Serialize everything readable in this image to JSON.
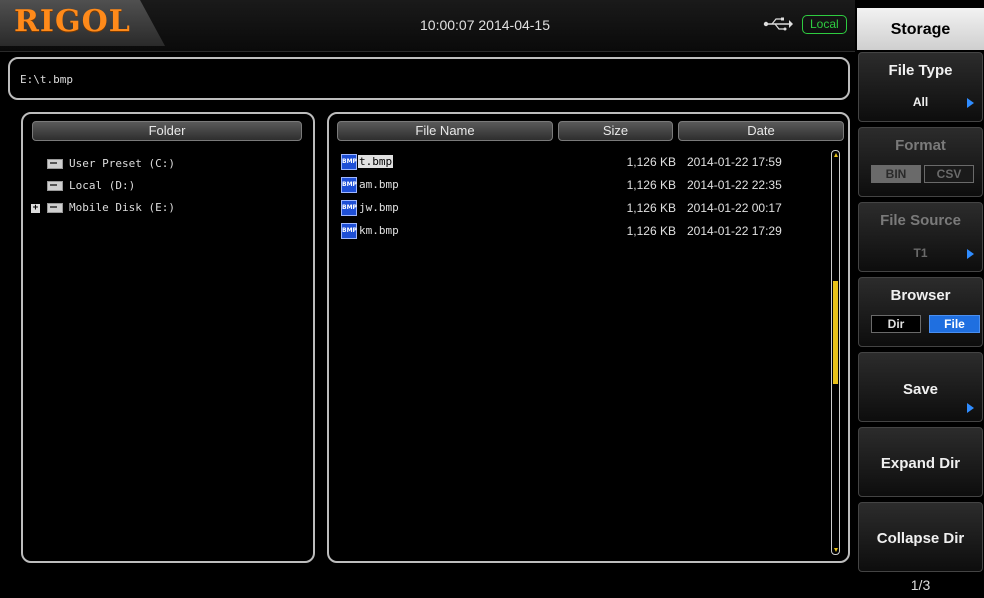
{
  "header": {
    "logo": "RIGOL",
    "datetime": "10:00:07 2014-04-15",
    "usb_icon": "usb-icon",
    "mode_badge": "Local",
    "colors": {
      "logo": "#ff8a1a",
      "badge": "#2ecc40",
      "accent": "#2f8cff",
      "scroll": "#e8c21a"
    }
  },
  "path": {
    "value": "E:\\t.bmp"
  },
  "folder_panel": {
    "header": "Folder",
    "items": [
      {
        "label": "User Preset (C:)",
        "expandable": false
      },
      {
        "label": "Local (D:)",
        "expandable": false
      },
      {
        "label": "Mobile Disk (E:)",
        "expandable": true,
        "selected": true
      }
    ]
  },
  "file_panel": {
    "columns": {
      "name": "File Name",
      "size": "Size",
      "date": "Date"
    },
    "icon_text": "BMP",
    "files": [
      {
        "name": "t.bmp",
        "size": "1,126 KB",
        "date": "2014-01-22 17:59",
        "selected": true
      },
      {
        "name": "am.bmp",
        "size": "1,126 KB",
        "date": "2014-01-22 22:35",
        "selected": false
      },
      {
        "name": "jw.bmp",
        "size": "1,126 KB",
        "date": "2014-01-22 00:17",
        "selected": false
      },
      {
        "name": "km.bmp",
        "size": "1,126 KB",
        "date": "2014-01-22 17:29",
        "selected": false
      }
    ]
  },
  "menu": {
    "title": "Storage",
    "file_type": {
      "label": "File Type",
      "value": "All"
    },
    "format": {
      "label": "Format",
      "options": [
        "BIN",
        "CSV"
      ],
      "selected": "BIN",
      "enabled": false
    },
    "file_source": {
      "label": "File Source",
      "value": "T1",
      "enabled": false
    },
    "browser": {
      "label": "Browser",
      "options": [
        "Dir",
        "File"
      ],
      "selected": "File"
    },
    "save": {
      "label": "Save"
    },
    "expand_dir": {
      "label": "Expand Dir"
    },
    "collapse_dir": {
      "label": "Collapse Dir"
    },
    "page": "1/3"
  }
}
